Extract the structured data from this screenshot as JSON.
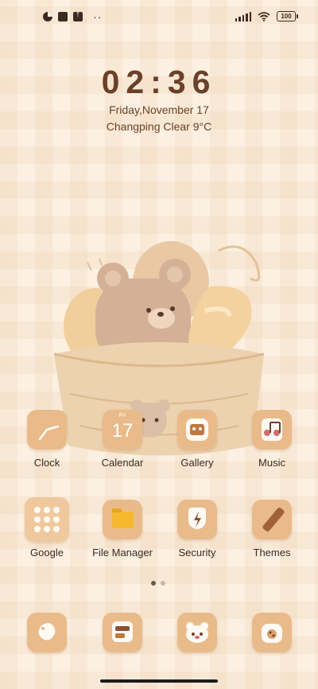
{
  "status_bar": {
    "left_icons": [
      "circle-half-icon",
      "square-icon",
      "upload-icon"
    ],
    "more": "··",
    "battery": "100"
  },
  "clock_widget": {
    "time": "02:36",
    "date": "Friday,November 17",
    "weather": "Changping Clear 9°C"
  },
  "apps": [
    {
      "label": "Clock",
      "icon": "clock-icon"
    },
    {
      "label": "Calendar",
      "icon": "calendar-icon",
      "day_name": "Fri",
      "day": "17"
    },
    {
      "label": "Gallery",
      "icon": "gallery-icon"
    },
    {
      "label": "Music",
      "icon": "music-icon"
    },
    {
      "label": "Google",
      "icon": "google-folder-icon"
    },
    {
      "label": "File Manager",
      "icon": "folder-icon"
    },
    {
      "label": "Security",
      "icon": "shield-icon"
    },
    {
      "label": "Themes",
      "icon": "brush-icon"
    }
  ],
  "dock": [
    "phone-icon",
    "messages-icon",
    "browser-icon",
    "camera-icon"
  ],
  "pages": {
    "count": 2,
    "active": 1
  },
  "colors": {
    "accent": "#e9bb8a",
    "text": "#6b4028",
    "background": "#fcf0e2"
  }
}
